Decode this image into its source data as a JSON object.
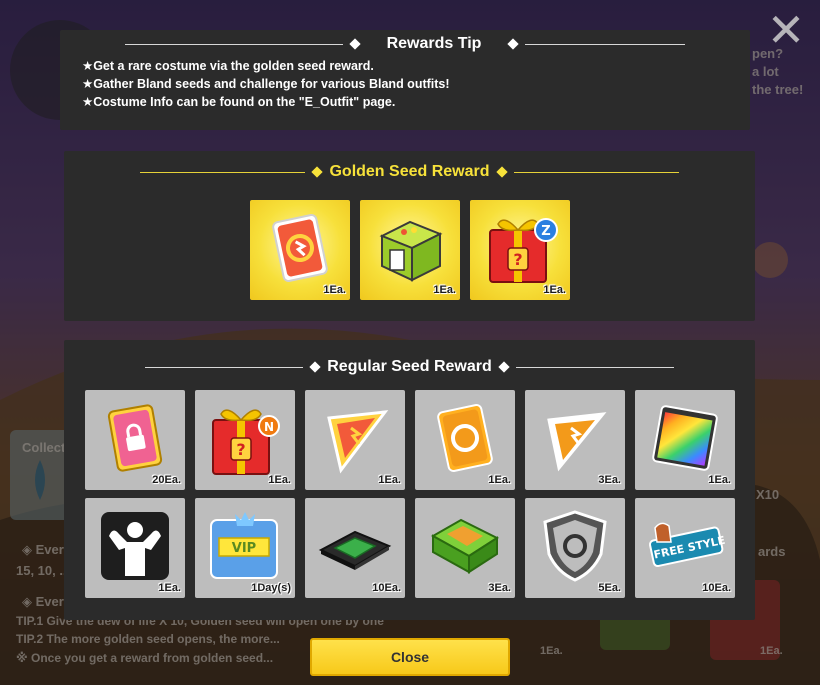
{
  "background": {
    "right_text_lines": [
      "pen?",
      "a lot",
      "the tree!"
    ],
    "collect_label": "Collect",
    "left_lines": [
      "◈ Every",
      "15, 10, ..",
      "◈ Every"
    ],
    "tip1": "TIP.1 Give the dew of life X 10, Golden seed will open one by one",
    "tip2": "TIP.2 The more golden seed opens, the more...",
    "tip3": "※ Once you get a reward from golden seed...",
    "rewards_tab": "ards",
    "x10": "X10",
    "qty_left": "1Ea.",
    "qty_right": "1Ea."
  },
  "close_x_glyph": "✕",
  "rewards_tip": {
    "title": "Rewards Tip",
    "lines": [
      "★Get a rare costume via the golden seed reward.",
      "★Gather Bland seeds and challenge for various Bland outfits!",
      "★Costume Info can be found on the \"E_Outfit\" page."
    ]
  },
  "golden": {
    "title": "Golden Seed Reward",
    "items": [
      {
        "icon": "costume-ticket-icon",
        "qty": "1Ea."
      },
      {
        "icon": "green-machine-box-icon",
        "qty": "1Ea."
      },
      {
        "icon": "z-gift-box-icon",
        "qty": "1Ea."
      }
    ]
  },
  "regular": {
    "title": "Regular Seed Reward",
    "items": [
      {
        "icon": "lock-ticket-icon",
        "qty": "20Ea."
      },
      {
        "icon": "n-gift-box-icon",
        "qty": "1Ea."
      },
      {
        "icon": "ticket-piece-icon",
        "qty": "1Ea."
      },
      {
        "icon": "orange-ticket-icon",
        "qty": "1Ea."
      },
      {
        "icon": "orange-ticket-piece-icon",
        "qty": "3Ea."
      },
      {
        "icon": "color-palette-card-icon",
        "qty": "1Ea."
      },
      {
        "icon": "muscle-silhouette-icon",
        "qty": "1Ea."
      },
      {
        "icon": "vip-card-icon",
        "qty": "1Day(s)"
      },
      {
        "icon": "microchip-icon",
        "qty": "10Ea."
      },
      {
        "icon": "green-cartridge-icon",
        "qty": "3Ea."
      },
      {
        "icon": "shield-refresh-icon",
        "qty": "5Ea."
      },
      {
        "icon": "free-style-tag-icon",
        "qty": "10Ea."
      }
    ],
    "vip_text": "VIP",
    "freestyle_text": "FREE STYLE"
  },
  "close_button": "Close"
}
